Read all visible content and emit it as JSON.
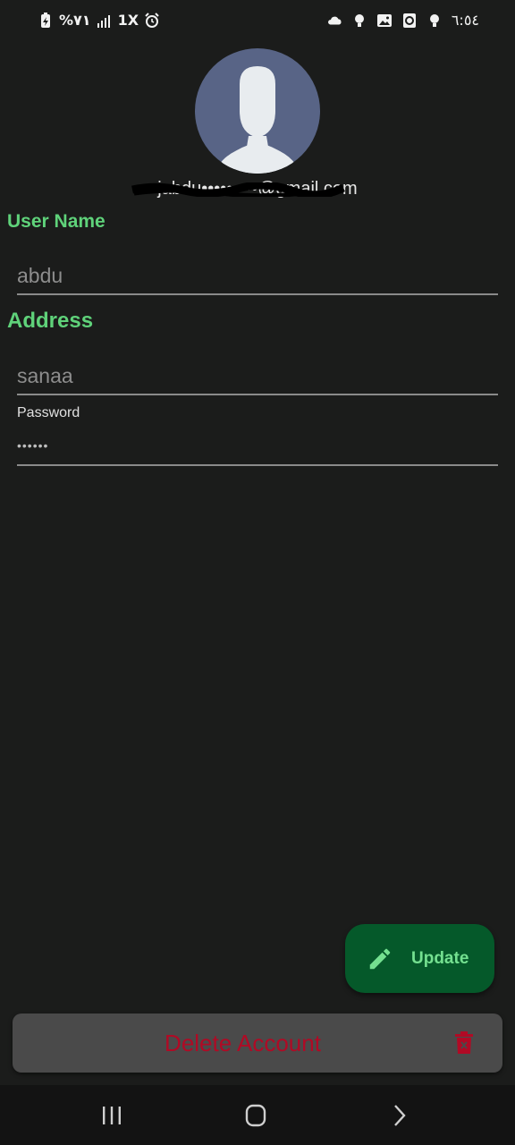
{
  "status_bar": {
    "battery_text": "%٧١",
    "network_text": "1X",
    "time": "٦:٥٤"
  },
  "profile": {
    "email": "jabdu•••••••••@gmail.com"
  },
  "form": {
    "username_label": "User Name",
    "username_value": "abdu",
    "address_label": "Address",
    "address_value": "sanaa",
    "password_label": "Password",
    "password_value": "••••••"
  },
  "actions": {
    "update_label": "Update",
    "delete_label": "Delete Account"
  },
  "colors": {
    "accent_green": "#5fd27a",
    "update_bg": "#05592a",
    "danger_red": "#b00a25",
    "avatar_bg": "#586486"
  }
}
